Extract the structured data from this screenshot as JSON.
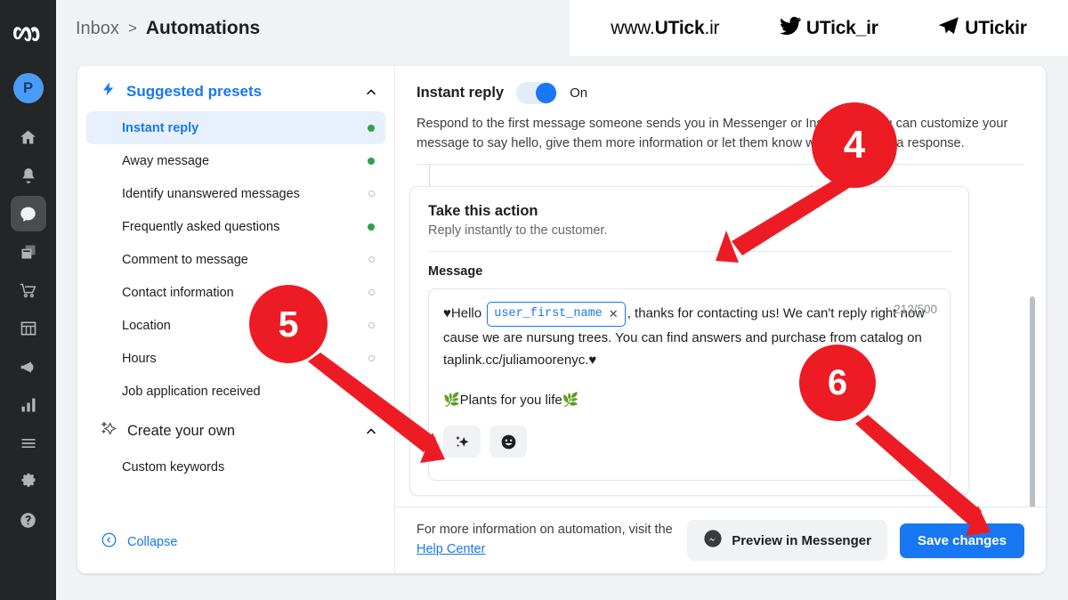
{
  "rail": {
    "logo_icon": "meta-logo-icon",
    "avatar_initial": "P",
    "icons": [
      {
        "name": "home-icon",
        "active": false
      },
      {
        "name": "bell-icon",
        "active": false
      },
      {
        "name": "chat-bubble-icon",
        "active": true
      },
      {
        "name": "pages-icon",
        "active": false
      },
      {
        "name": "shopping-cart-icon",
        "active": false
      },
      {
        "name": "grid-table-icon",
        "active": false
      },
      {
        "name": "megaphone-icon",
        "active": false
      },
      {
        "name": "bar-chart-icon",
        "active": false
      },
      {
        "name": "menu-icon",
        "active": false
      },
      {
        "name": "gear-icon",
        "active": false
      },
      {
        "name": "help-circle-icon",
        "active": false
      }
    ]
  },
  "breadcrumb": {
    "parent": "Inbox",
    "separator": ">",
    "current": "Automations"
  },
  "watermark": {
    "site_prefix": "www.",
    "site_bold": "UTick",
    "site_suffix": ".ir",
    "twitter_handle": "UTick_ir",
    "telegram_handle": "UTickir"
  },
  "presets": {
    "section_label": "Suggested presets",
    "section_icon": "lightning-bolt-icon",
    "collapse_icon": "chevron-up-icon",
    "items": [
      {
        "label": "Instant reply",
        "status": "on",
        "selected": true
      },
      {
        "label": "Away message",
        "status": "on",
        "selected": false
      },
      {
        "label": "Identify unanswered messages",
        "status": "off",
        "selected": false
      },
      {
        "label": "Frequently asked questions",
        "status": "on",
        "selected": false
      },
      {
        "label": "Comment to message",
        "status": "off",
        "selected": false
      },
      {
        "label": "Contact information",
        "status": "off",
        "selected": false
      },
      {
        "label": "Location",
        "status": "off",
        "selected": false
      },
      {
        "label": "Hours",
        "status": "off",
        "selected": false
      },
      {
        "label": "Job application received",
        "status": "none",
        "selected": false
      }
    ],
    "create_section_label": "Create your own",
    "create_section_icon": "sparkle-icon",
    "create_items": [
      {
        "label": "Custom keywords"
      }
    ],
    "collapse_label": "Collapse",
    "collapse_button_icon": "chevron-left-circle-icon"
  },
  "detail": {
    "title": "Instant reply",
    "toggle_state": "On",
    "toggle_on": true,
    "description": "Respond to the first message someone sends you in Messenger or Instagram. You can customize your message to say hello, give them more information or let them know when to expect a response.",
    "action_title": "Take this action",
    "action_subtitle": "Reply instantly to the customer.",
    "message_label": "Message",
    "message": {
      "lead_emoji": "♥",
      "greeting": "Hello",
      "chip_label": "user_first_name",
      "chip_remove_icon": "close-icon",
      "body": ", thanks for contacting us! We can't reply right now cause we are nursung trees. You can find answers and purchase from catalog on taplink.cc/juliamoorenyc.",
      "trail_emoji": "♥",
      "second_line": "🌿Plants for you life🌿",
      "counter": "212/500"
    },
    "tools": [
      {
        "name": "personalize-sparkle-icon"
      },
      {
        "name": "emoji-picker-icon"
      }
    ],
    "footer": {
      "text": "For more information on automation, visit the",
      "link": "Help Center",
      "preview_label": "Preview in Messenger",
      "preview_icon": "messenger-icon",
      "save_label": "Save changes"
    }
  },
  "annotations": {
    "accent_color": "#ed1c24",
    "badges": [
      {
        "label": "4"
      },
      {
        "label": "5"
      },
      {
        "label": "6"
      }
    ]
  },
  "colors": {
    "brand_blue": "#1877f2",
    "status_green": "#31a24c",
    "rail_dark": "#242526",
    "page_bg": "#f0f2f5"
  }
}
